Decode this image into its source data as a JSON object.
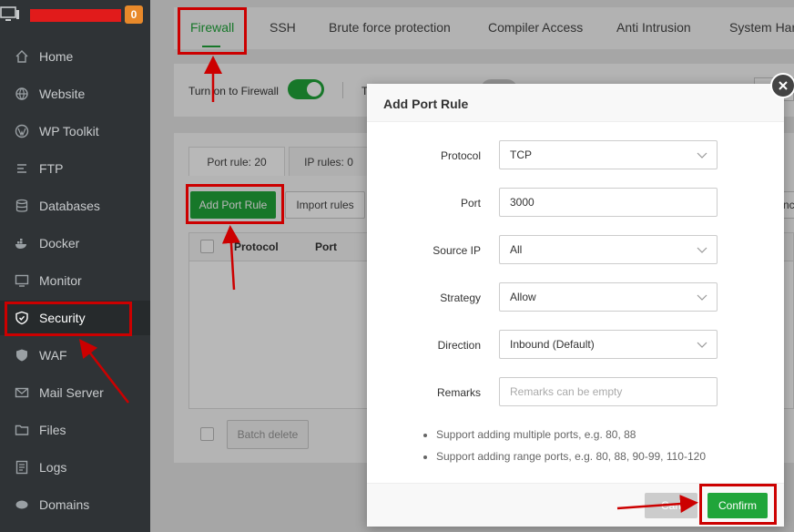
{
  "sidebar": {
    "badge": "0",
    "items": [
      {
        "label": "Home",
        "icon": "home-icon"
      },
      {
        "label": "Website",
        "icon": "globe-icon"
      },
      {
        "label": "WP Toolkit",
        "icon": "wordpress-icon"
      },
      {
        "label": "FTP",
        "icon": "ftp-icon"
      },
      {
        "label": "Databases",
        "icon": "database-icon"
      },
      {
        "label": "Docker",
        "icon": "docker-icon"
      },
      {
        "label": "Monitor",
        "icon": "monitor-icon"
      },
      {
        "label": "Security",
        "icon": "shield-icon"
      },
      {
        "label": "WAF",
        "icon": "waf-shield-icon"
      },
      {
        "label": "Mail Server",
        "icon": "mail-icon"
      },
      {
        "label": "Files",
        "icon": "folder-icon"
      },
      {
        "label": "Logs",
        "icon": "logs-icon"
      },
      {
        "label": "Domains",
        "icon": "domains-icon"
      }
    ]
  },
  "tabs": [
    "Firewall",
    "SSH",
    "Brute force protection",
    "Compiler Access",
    "Anti Intrusion",
    "System Hard"
  ],
  "firewall": {
    "toggle_label": "Turn on to Firewall",
    "second_label_fragment": "T"
  },
  "subtabs": {
    "port_rule": "Port rule: 20",
    "ip_rules": "IP rules: 0"
  },
  "toolbar": {
    "add_port_rule": "Add Port Rule",
    "import_rules": "Import rules",
    "right_fragment": "nc"
  },
  "table": {
    "headers": [
      "Protocol",
      "Port"
    ]
  },
  "batch_delete": "Batch delete",
  "modal": {
    "title": "Add Port Rule",
    "fields": {
      "protocol": {
        "label": "Protocol",
        "value": "TCP"
      },
      "port": {
        "label": "Port",
        "value": "3000"
      },
      "source_ip": {
        "label": "Source IP",
        "value": "All"
      },
      "strategy": {
        "label": "Strategy",
        "value": "Allow"
      },
      "direction": {
        "label": "Direction",
        "value": "Inbound (Default)"
      },
      "remarks": {
        "label": "Remarks",
        "placeholder": "Remarks can be empty"
      }
    },
    "tips": [
      "Support adding multiple ports, e.g. 80, 88",
      "Support adding range ports, e.g. 80, 88, 90-99, 110-120"
    ],
    "cancel": "Can",
    "confirm": "Confirm"
  },
  "colors": {
    "accent": "#20a53a",
    "annotation": "#cc0000",
    "sidebar_bg": "#2f3336"
  }
}
